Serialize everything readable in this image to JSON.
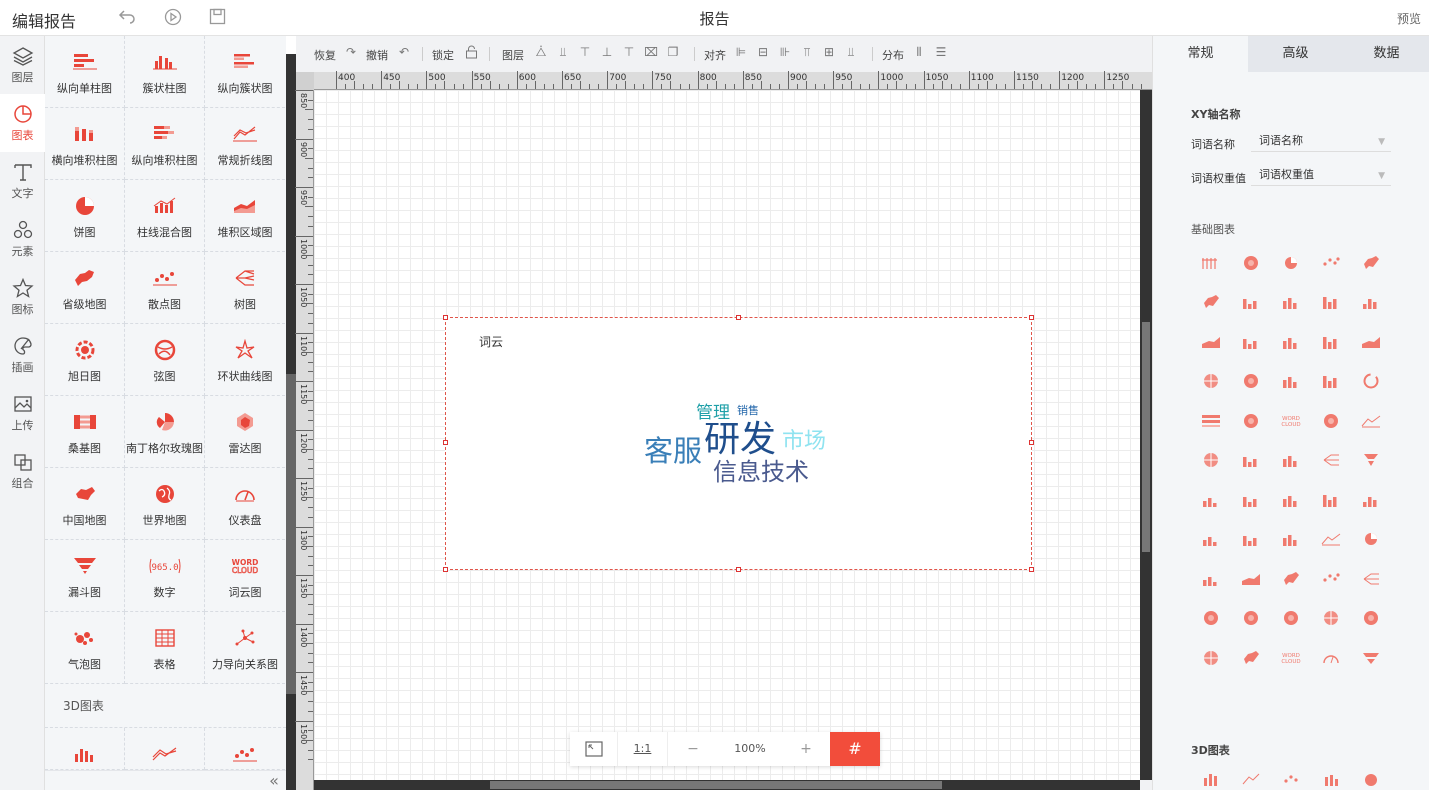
{
  "topbar": {
    "title": "编辑报告",
    "center_title": "报告",
    "preview": "预览"
  },
  "leftnav": [
    {
      "label": "图层",
      "icon": "layers-icon"
    },
    {
      "label": "图表",
      "icon": "chart-clock-icon"
    },
    {
      "label": "文字",
      "icon": "text-t-icon"
    },
    {
      "label": "元素",
      "icon": "shapes-icon"
    },
    {
      "label": "图标",
      "icon": "star-icon"
    },
    {
      "label": "插画",
      "icon": "palette-icon"
    },
    {
      "label": "上传",
      "icon": "image-upload-icon"
    },
    {
      "label": "组合",
      "icon": "group-icon"
    }
  ],
  "palette": {
    "items": [
      "纵向单柱图",
      "簇状柱图",
      "纵向簇状图",
      "横向堆积柱图",
      "纵向堆积柱图",
      "常规折线图",
      "饼图",
      "柱线混合图",
      "堆积区域图",
      "省级地图",
      "散点图",
      "树图",
      "旭日图",
      "弦图",
      "环状曲线图",
      "桑基图",
      "南丁格尔玫瑰图",
      "雷达图",
      "中国地图",
      "世界地图",
      "仪表盘",
      "漏斗图",
      "数字",
      "词云图",
      "气泡图",
      "表格",
      "力导向关系图"
    ],
    "section_3d": "3D图表"
  },
  "toolbar": {
    "redo": "恢复",
    "undo": "撤销",
    "lock": "锁定",
    "layer": "图层",
    "align": "对齐",
    "distribute": "分布"
  },
  "ruler": {
    "h_labels": [
      "400",
      "450",
      "500",
      "550",
      "600",
      "650",
      "700",
      "750",
      "800",
      "850",
      "900",
      "950",
      "1000",
      "1050",
      "1100",
      "1150",
      "1200",
      "1250"
    ],
    "v_labels": [
      "850",
      "900",
      "950",
      "1000",
      "1050",
      "1100",
      "1150",
      "1200",
      "1250",
      "1300",
      "1350",
      "1400",
      "1450",
      "1500"
    ]
  },
  "widget": {
    "title": "词云",
    "words": [
      {
        "text": "研发",
        "color": "#1f4e8c"
      },
      {
        "text": "客服",
        "color": "#3a7fb8"
      },
      {
        "text": "信息技术",
        "color": "#4a5a8e"
      },
      {
        "text": "市场",
        "color": "#8fe3f0"
      },
      {
        "text": "管理",
        "color": "#1fa0a8"
      },
      {
        "text": "销售",
        "color": "#2266aa"
      }
    ]
  },
  "zoombar": {
    "fit": "⤢",
    "one_to_one": "1:1",
    "minus": "−",
    "zoom": "100%",
    "plus": "+",
    "grid": "#"
  },
  "rpanel": {
    "tabs": [
      "常规",
      "高级",
      "数据"
    ],
    "xy_title": "XY轴名称",
    "word_name_label": "词语名称",
    "word_name_value": "词语名称",
    "word_weight_label": "词语权重值",
    "word_weight_value": "词语权重值",
    "basic_title": "基础图表",
    "title_3d": "3D图表"
  },
  "colors": {
    "accent": "#f24d3b",
    "icon_red": "#e8463a"
  }
}
